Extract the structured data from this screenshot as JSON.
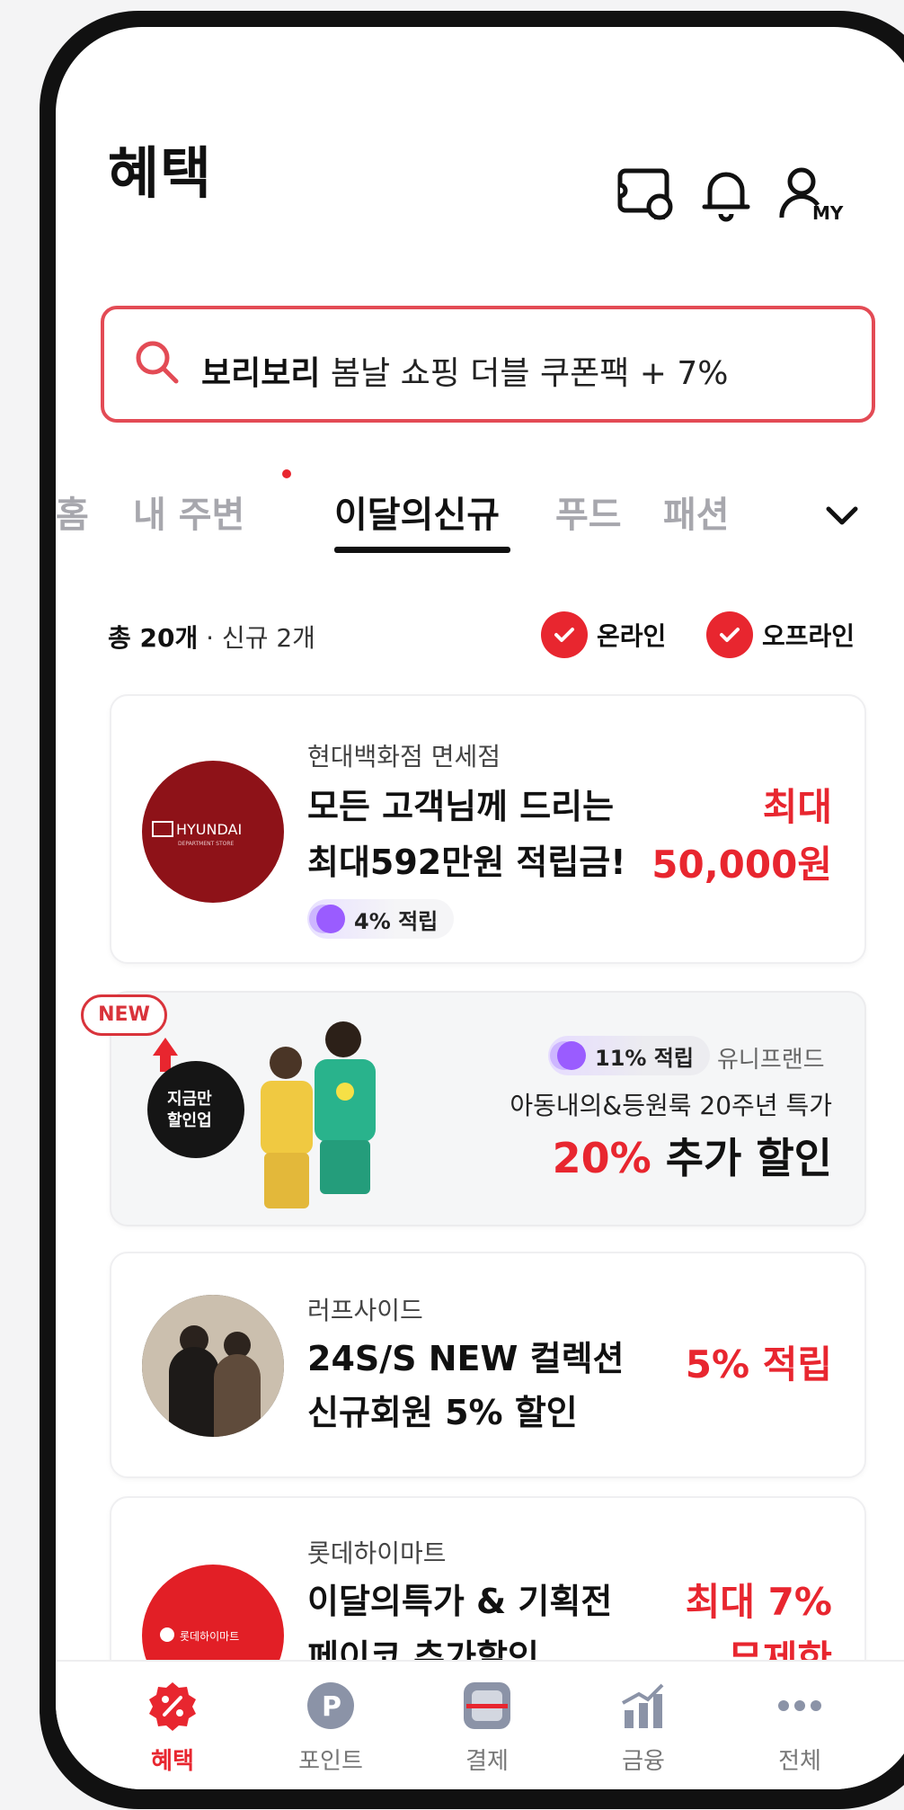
{
  "header": {
    "title": "혜택"
  },
  "search": {
    "brand": "보리보리",
    "text": " 봄날 쇼핑 더블 쿠폰팩 + 7%"
  },
  "tabs": [
    {
      "label": "홈"
    },
    {
      "label": "내 주변"
    },
    {
      "label": "이달의신규"
    },
    {
      "label": "푸드"
    },
    {
      "label": "패션"
    }
  ],
  "summary": {
    "total": "총 20개",
    "new": " · 신규 2개"
  },
  "filters": {
    "online": "온라인",
    "offline": "오프라인"
  },
  "cards": [
    {
      "logo_text": "HYUNDAI",
      "logo_sub": "DEPARTMENT STORE",
      "store": "현대백화점 면세점",
      "headline_1": "모든 고객님께 드리는",
      "headline_2": "최대592만원 적립금!",
      "benefit_1": "최대",
      "benefit_2": "50,000원",
      "pill": "4% 적립"
    },
    {
      "store": "러프사이드",
      "headline_1": "24S/S NEW 컬렉션",
      "headline_2": "신규회원 5% 할인",
      "benefit_1": "5% 적립"
    },
    {
      "logo_text": "롯데하이마트",
      "store": "롯데하이마트",
      "headline_1": "이달의특가 & 기획전",
      "headline_2": "페이코 추가할인",
      "benefit_1": "최대 7%",
      "benefit_2": "무제한"
    }
  ],
  "banner": {
    "badge": "NEW",
    "sticker": "지금만\n할인업",
    "pill": "11% 적립",
    "store": "유니프랜드",
    "subtitle": "아동내의&등원룩 20주년 특가",
    "headline_red": "20%",
    "headline_rest": " 추가 할인"
  },
  "bottom_nav": [
    {
      "label": "혜택",
      "icon": "percent-badge-icon"
    },
    {
      "label": "포인트",
      "icon": "point-p-icon"
    },
    {
      "label": "결제",
      "icon": "scan-pay-icon"
    },
    {
      "label": "금융",
      "icon": "chart-growth-icon"
    },
    {
      "label": "전체",
      "icon": "more-dots-icon"
    }
  ],
  "colors": {
    "accent": "#e8262f",
    "search_border": "#e34b55",
    "inactive": "#a7a7ad"
  }
}
